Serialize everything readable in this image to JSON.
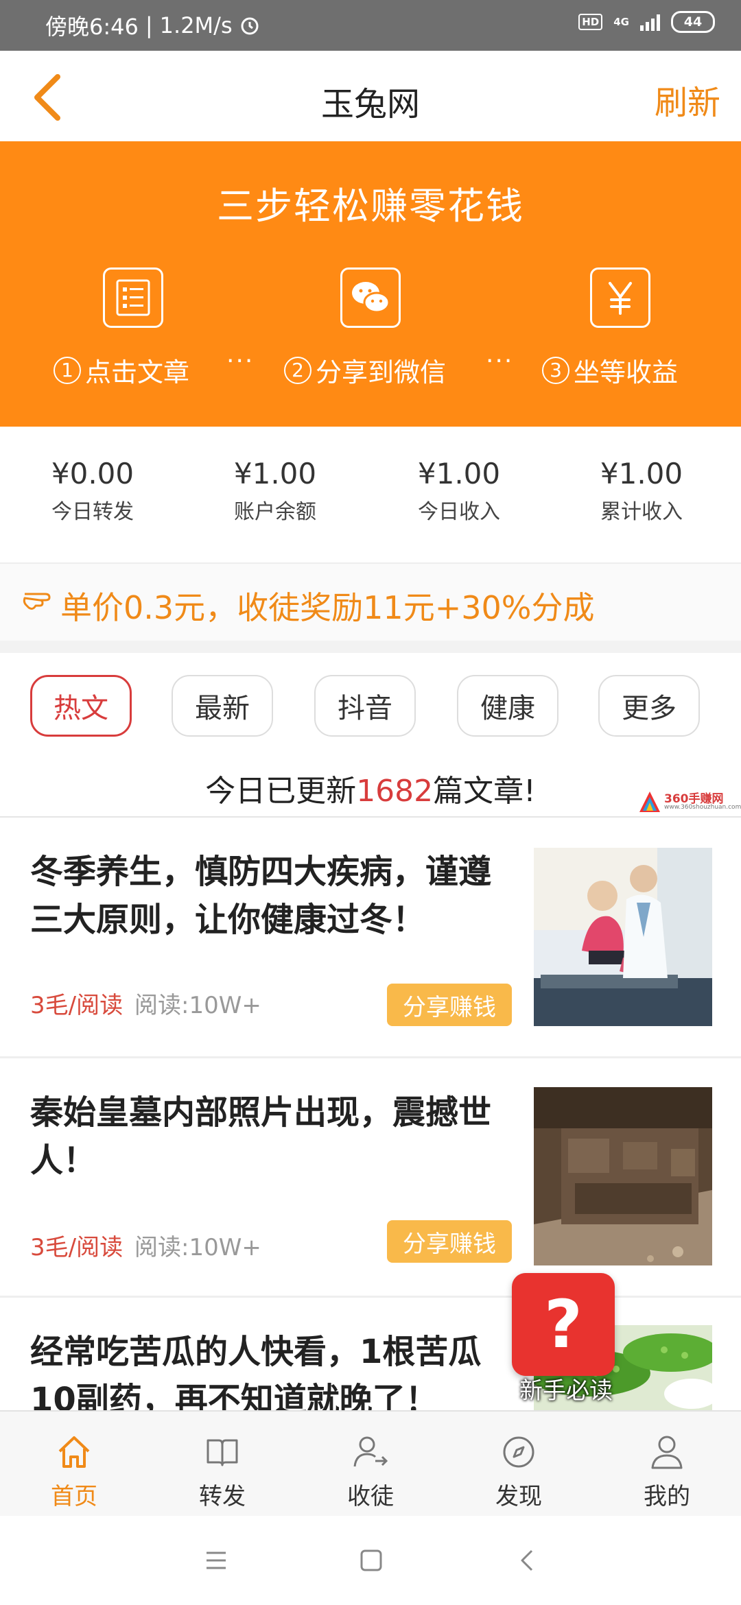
{
  "status_bar": {
    "time": "傍晚6:46",
    "speed": "1.2M/s",
    "hd": "HD",
    "network": "4G",
    "battery": "44"
  },
  "header": {
    "title": "玉兔网",
    "refresh_label": "刷新"
  },
  "banner": {
    "title": "三步轻松赚零花钱",
    "steps": [
      {
        "num": "1",
        "label": "点击文章",
        "icon": "article-list-icon"
      },
      {
        "num": "2",
        "label": "分享到微信",
        "icon": "wechat-icon"
      },
      {
        "num": "3",
        "label": "坐等收益",
        "icon": "yuan-icon"
      }
    ],
    "dots": "···"
  },
  "stats": [
    {
      "value": "¥0.00",
      "label": "今日转发"
    },
    {
      "value": "¥1.00",
      "label": "账户余额"
    },
    {
      "value": "¥1.00",
      "label": "今日收入"
    },
    {
      "value": "¥1.00",
      "label": "累计收入"
    }
  ],
  "promo": {
    "text": "单价0.3元，收徒奖励11元+30%分成"
  },
  "tabs": [
    {
      "label": "热文",
      "active": true
    },
    {
      "label": "最新",
      "active": false
    },
    {
      "label": "抖音",
      "active": false
    },
    {
      "label": "健康",
      "active": false
    },
    {
      "label": "更多",
      "active": false
    }
  ],
  "update": {
    "prefix": "今日已更新",
    "count": "1682",
    "suffix": "篇文章!"
  },
  "watermark": {
    "name": "360手赚网",
    "url": "www.360shouzhuan.com"
  },
  "articles": [
    {
      "title": "冬季养生，慎防四大疾病，谨遵三大原则，让你健康过冬！",
      "price": "3毛/阅读",
      "reads": "阅读:10W+",
      "share_label": "分享赚钱"
    },
    {
      "title": "秦始皇墓内部照片出现，震撼世人！",
      "price": "3毛/阅读",
      "reads": "阅读:10W+",
      "share_label": "分享赚钱"
    },
    {
      "title": "经常吃苦瓜的人快看，1根苦瓜10副药，再不知道就晚了！"
    }
  ],
  "help": {
    "symbol": "?",
    "label": "新手必读"
  },
  "bottom_nav": [
    {
      "label": "首页",
      "icon": "home-icon",
      "active": true
    },
    {
      "label": "转发",
      "icon": "book-icon",
      "active": false
    },
    {
      "label": "收徒",
      "icon": "add-follower-icon",
      "active": false
    },
    {
      "label": "发现",
      "icon": "compass-icon",
      "active": false
    },
    {
      "label": "我的",
      "icon": "profile-icon",
      "active": false
    }
  ],
  "colors": {
    "brand_orange": "#ff8a14",
    "accent_red": "#d83c3c",
    "share_button": "#f9b94a"
  }
}
